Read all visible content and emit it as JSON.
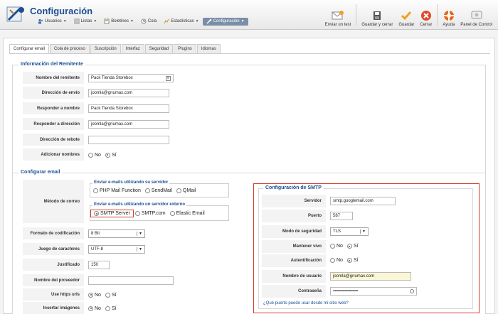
{
  "header": {
    "title": "Configuración",
    "menu": [
      {
        "label": "Usuarios",
        "icon": "users-icon",
        "active": false
      },
      {
        "label": "Listas",
        "icon": "list-icon",
        "active": false
      },
      {
        "label": "Boletines",
        "icon": "newsletter-icon",
        "active": false
      },
      {
        "label": "Cola",
        "icon": "queue-icon",
        "active": false
      },
      {
        "label": "Estadísticas",
        "icon": "stats-icon",
        "active": false
      },
      {
        "label": "Configuración",
        "icon": "config-icon",
        "active": true
      }
    ],
    "toolbar": {
      "send_test": "Enviar un test",
      "save_close": "Guardar y cerrar",
      "save": "Guardar",
      "close": "Cerrar",
      "help": "Ayuda",
      "control_panel": "Panel de Control"
    }
  },
  "tabs": [
    "Configurar email",
    "Cola de proceso",
    "Suscripción",
    "Interfaz",
    "Seguridad",
    "Plugins",
    "Idiomas"
  ],
  "sender": {
    "legend": "Información del Remitente",
    "sender_name_label": "Nombre del remitente",
    "sender_name": "Pack Tienda Storebox",
    "from_address_label": "Dirección de envío",
    "from_address": "joomla@gnumax.com",
    "reply_name_label": "Responder a nombre",
    "reply_name": "Pack Tienda Storebox",
    "reply_address_label": "Responder a dirección",
    "reply_address": "joomla@gnumax.com",
    "bounce_label": "Dirección de rebote",
    "bounce": "",
    "add_names_label": "Adicionar nombres",
    "opt_no": "No",
    "opt_si": "Sí"
  },
  "email": {
    "legend": "Configurar email",
    "method_label": "Método de correo",
    "server_legend": "Enviar e-mails utilizando su servidor",
    "php_mail": "PHP Mail Function",
    "sendmail": "SendMail",
    "qmail": "QMail",
    "external_legend": "Enviar e-mails utilizando un servidor externo",
    "smtp_server": "SMTP Server",
    "smtp_com": "SMTP.com",
    "elastic": "Elastic Email",
    "encoding_label": "Formato de codificación",
    "encoding": "8 Bit",
    "charset_label": "Juego de caracteres",
    "charset": "UTF-8",
    "justify_label": "Justificado",
    "justify": "150",
    "provider_label": "Nombre del proveedor",
    "provider": "",
    "https_label": "Use https urls",
    "images_label": "Insertar imágenes",
    "opt_no": "No",
    "opt_si": "Sí"
  },
  "smtp": {
    "legend": "Configuración de SMTP",
    "server_label": "Servidor",
    "server": "smtp.googlemail.com",
    "port_label": "Puerto",
    "port": "587",
    "security_label": "Modo de seguridad",
    "security": "TLS",
    "keepalive_label": "Mantener vivo",
    "auth_label": "Autentificación",
    "username_label": "Nombre de usuario",
    "username": "joomla@gnumax.com",
    "password_label": "Contraseña",
    "password": "••••••••••••••••••••••••••••",
    "help_link": "¿Qué puerto puedo usar desde mi sitio web?",
    "opt_no": "No",
    "opt_si": "Sí"
  },
  "colors": {
    "brand": "#1d4f91",
    "highlight": "#d43b2a"
  }
}
